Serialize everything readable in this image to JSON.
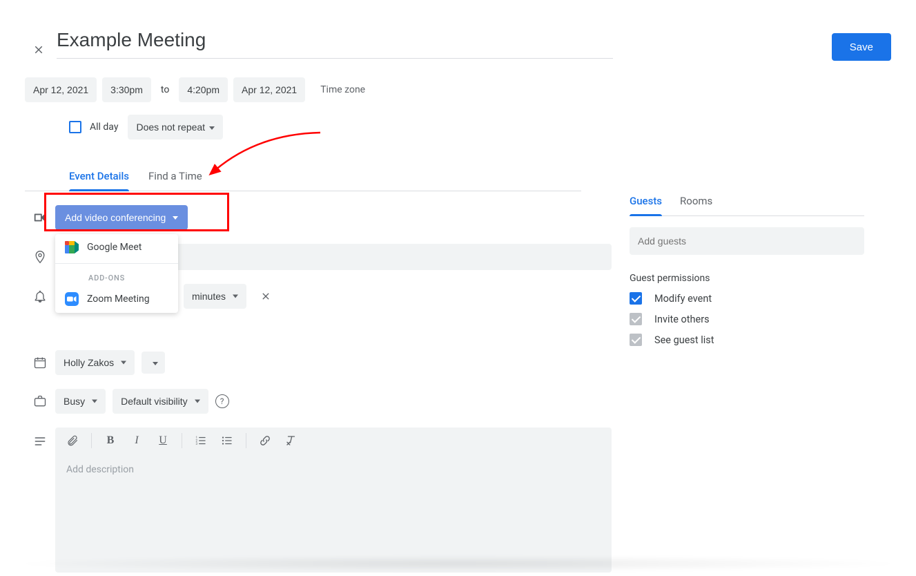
{
  "header": {
    "title": "Example Meeting",
    "save_label": "Save"
  },
  "datetime": {
    "start_date": "Apr 12, 2021",
    "start_time": "3:30pm",
    "to_label": "to",
    "end_time": "4:20pm",
    "end_date": "Apr 12, 2021",
    "timezone_label": "Time zone",
    "all_day_label": "All day",
    "repeat_label": "Does not repeat"
  },
  "tabs": {
    "event_details": "Event Details",
    "find_time": "Find a Time"
  },
  "video": {
    "button_label": "Add video conferencing",
    "menu": {
      "google_meet": "Google Meet",
      "addons_heading": "ADD-ONS",
      "zoom": "Zoom Meeting"
    }
  },
  "notification": {
    "unit_label": "minutes"
  },
  "calendar": {
    "owner": "Holly Zakos"
  },
  "availability": {
    "busy_label": "Busy",
    "visibility_label": "Default visibility"
  },
  "description": {
    "placeholder": "Add description"
  },
  "right": {
    "tabs": {
      "guests": "Guests",
      "rooms": "Rooms"
    },
    "add_guests_placeholder": "Add guests",
    "permissions_title": "Guest permissions",
    "modify_label": "Modify event",
    "invite_label": "Invite others",
    "see_list_label": "See guest list"
  }
}
